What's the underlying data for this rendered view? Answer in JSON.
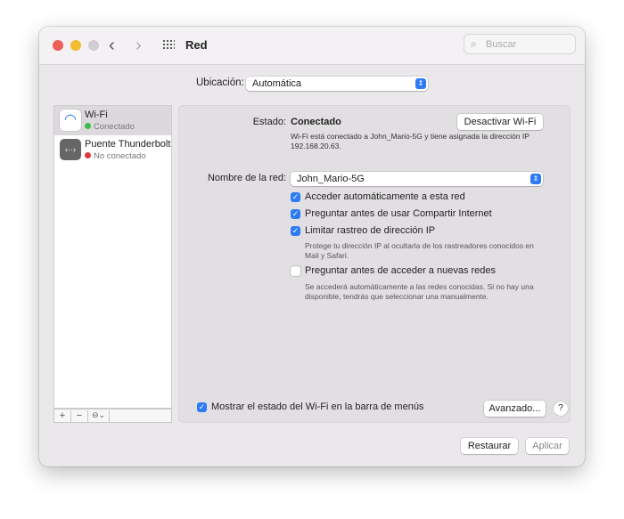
{
  "window": {
    "title": "Red",
    "search_placeholder": "Buscar"
  },
  "location": {
    "label": "Ubicación:",
    "value": "Automática"
  },
  "services": [
    {
      "name": "Wi-Fi",
      "status": "Conectado",
      "status_color": "#3dbb4a",
      "selected": true
    },
    {
      "name": "Puente Thunderbolt",
      "status": "No conectado",
      "status_color": "#e0383a",
      "selected": false
    }
  ],
  "list_toolbar": {
    "add": "+",
    "remove": "−",
    "action": "⊖⌄"
  },
  "detail": {
    "status_label": "Estado:",
    "status_value": "Conectado",
    "toggle_button": "Desactivar Wi-Fi",
    "status_desc": "Wi-Fi está conectado a John_Mario-5G y tiene asignada la dirección IP 192.168.20.63.",
    "network_label": "Nombre de la red:",
    "network_value": "John_Mario-5G",
    "options": [
      {
        "label": "Acceder automáticamente a esta red",
        "checked": true
      },
      {
        "label": "Preguntar antes de usar Compartir Internet",
        "checked": true
      },
      {
        "label": "Limitar rastreo de dirección IP",
        "checked": true,
        "note": "Protege tu dirección IP al ocultarla de los rastreadores conocidos en Mail y Safari."
      },
      {
        "label": "Preguntar antes de acceder a nuevas redes",
        "checked": false,
        "note": "Se accederá automáticamente a las redes conocidas. Si no hay una disponible, tendrás que seleccionar una manualmente."
      }
    ],
    "show_menu_label": "Mostrar el estado del Wi-Fi en la barra de menús",
    "show_menu_checked": true,
    "advanced_button": "Avanzado...",
    "help": "?"
  },
  "footer": {
    "revert": "Restaurar",
    "apply": "Aplicar"
  },
  "accent_color": "#2d7cf6"
}
